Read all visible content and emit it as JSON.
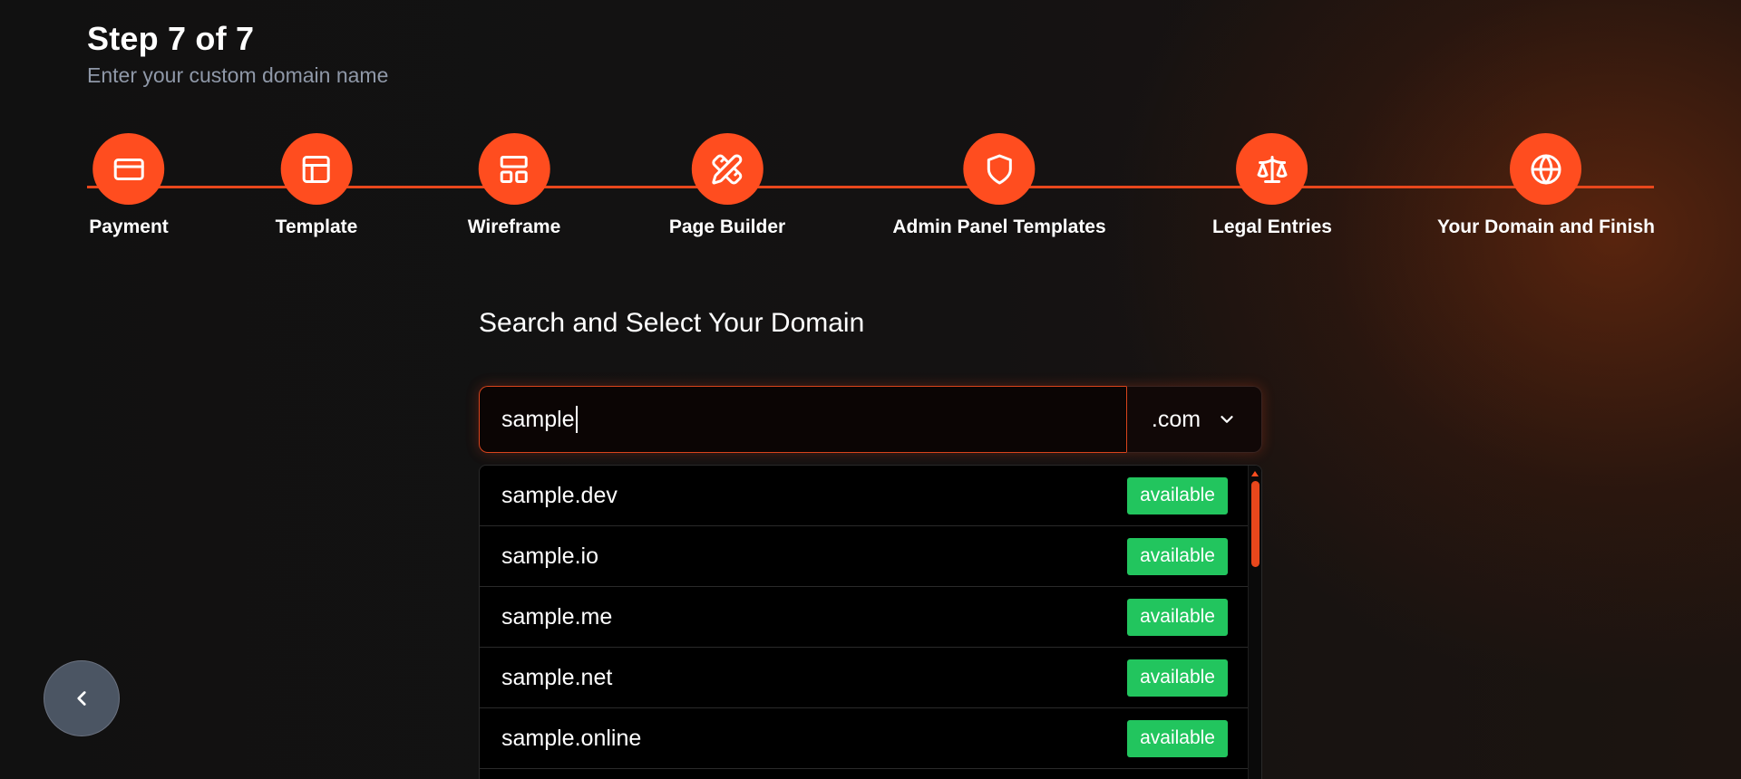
{
  "header": {
    "step_title": "Step 7 of 7",
    "subtitle": "Enter your custom domain name"
  },
  "stepper": {
    "accent_color": "#ff4d1f",
    "steps": [
      {
        "label": "Payment",
        "icon": "credit-card-icon"
      },
      {
        "label": "Template",
        "icon": "layout-icon"
      },
      {
        "label": "Wireframe",
        "icon": "wireframe-icon"
      },
      {
        "label": "Page Builder",
        "icon": "pencil-ruler-icon"
      },
      {
        "label": "Admin Panel Templates",
        "icon": "shield-icon"
      },
      {
        "label": "Legal Entries",
        "icon": "scale-icon"
      },
      {
        "label": "Your Domain and Finish",
        "icon": "globe-icon"
      }
    ]
  },
  "domain_search": {
    "section_title": "Search and Select Your Domain",
    "input_value": "sample",
    "tld_selected": ".com",
    "results": [
      {
        "domain": "sample.dev",
        "status": "available"
      },
      {
        "domain": "sample.io",
        "status": "available"
      },
      {
        "domain": "sample.me",
        "status": "available"
      },
      {
        "domain": "sample.net",
        "status": "available"
      },
      {
        "domain": "sample.online",
        "status": "available"
      }
    ],
    "status_color": "#22c55e"
  },
  "navigation": {
    "back_icon": "chevron-left-icon"
  }
}
